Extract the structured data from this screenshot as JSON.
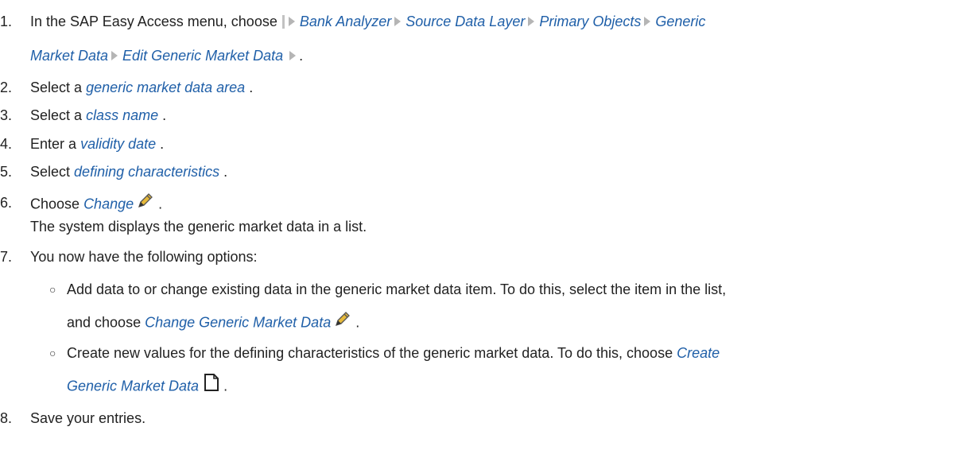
{
  "steps": [
    {
      "num": "1.",
      "prefix": "In the SAP Easy Access menu, choose",
      "path": [
        "Bank Analyzer",
        "Source Data Layer",
        "Primary Objects",
        "Generic"
      ],
      "path2": [
        "Market Data",
        "Edit Generic Market Data"
      ],
      "end": "."
    },
    {
      "num": "2.",
      "prefix": "Select a",
      "link": "generic market data area",
      "end": "."
    },
    {
      "num": "3.",
      "prefix": "Select a",
      "link": "class name",
      "end": "."
    },
    {
      "num": "4.",
      "prefix": "Enter a",
      "link": "validity date",
      "end": "."
    },
    {
      "num": "5.",
      "prefix": "Select",
      "link": "defining characteristics",
      "end": "."
    },
    {
      "num": "6.",
      "prefix": "Choose",
      "link": "Change",
      "end": ".",
      "result": "The system displays the generic market data in a list."
    },
    {
      "num": "7.",
      "text": "You now have the following options:",
      "options": [
        {
          "line1": "Add data to or change existing data in the generic market data item. To do this, select the item in the list,",
          "line2_prefix": "and choose",
          "line2_link": "Change Generic Market Data",
          "end": "."
        },
        {
          "line1": "Create new values for the defining characteristics of the generic market data. To do this, choose",
          "line1_link": "Create",
          "line2_link": "Generic Market Data",
          "end": "."
        }
      ]
    },
    {
      "num": "8.",
      "text": "Save your entries."
    }
  ],
  "colors": {
    "link": "#1f5fa8",
    "text": "#222222",
    "arrow": "#b5b5b5"
  },
  "icons": [
    "menu-path-start-icon",
    "path-arrow-icon",
    "pencil-icon",
    "document-icon"
  ]
}
